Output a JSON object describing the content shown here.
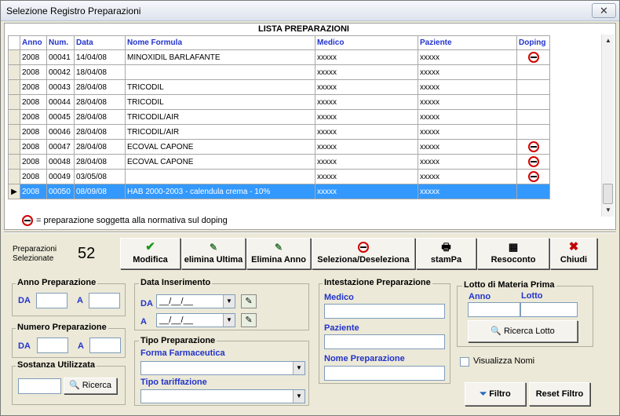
{
  "window": {
    "title": "Selezione Registro Preparazioni",
    "close_glyph": "✕"
  },
  "grid": {
    "caption": "LISTA PREPARAZIONI",
    "columns": [
      "Anno",
      "Num.",
      "Data",
      "Nome Formula",
      "Medico",
      "Paziente",
      "Doping"
    ],
    "rows": [
      [
        "2008",
        "00041",
        "14/04/08",
        "MINOXIDIL BARLAFANTE",
        "xxxxx",
        "xxxxx",
        "doping-icon"
      ],
      [
        "2008",
        "00042",
        "18/04/08",
        "",
        "xxxxx",
        "xxxxx",
        ""
      ],
      [
        "2008",
        "00043",
        "28/04/08",
        "TRICODIL",
        "xxxxx",
        "xxxxx",
        ""
      ],
      [
        "2008",
        "00044",
        "28/04/08",
        "TRICODIL",
        "xxxxx",
        "xxxxx",
        ""
      ],
      [
        "2008",
        "00045",
        "28/04/08",
        "TRICODIL/AIR",
        "xxxxx",
        "xxxxx",
        ""
      ],
      [
        "2008",
        "00046",
        "28/04/08",
        "TRICODIL/AIR",
        "xxxxx",
        "xxxxx",
        ""
      ],
      [
        "2008",
        "00047",
        "28/04/08",
        "ECOVAL CAPONE",
        "xxxxx",
        "xxxxx",
        "doping-icon"
      ],
      [
        "2008",
        "00048",
        "28/04/08",
        "ECOVAL CAPONE",
        "xxxxx",
        "xxxxx",
        "doping-icon"
      ],
      [
        "2008",
        "00049",
        "03/05/08",
        "",
        "xxxxx",
        "xxxxx",
        "doping-icon"
      ],
      [
        "2008",
        "00050",
        "08/09/08",
        "HAB 2000-2003 - calendula crema - 10%",
        "xxxxx",
        "xxxxx",
        ""
      ]
    ],
    "selected_row": 9,
    "legend": "= preparazione soggetta alla normativa sul doping"
  },
  "toolbar": {
    "count_label": "Preparazioni Selezionate",
    "count_value": "52",
    "modifica": "Modifica",
    "elimina_ultima": "elimina Ultima",
    "elimina_anno": "Elimina Anno",
    "seleziona": "Seleziona/Deseleziona",
    "stampa": "stamPa",
    "resoconto": "Resoconto",
    "chiudi": "Chiudi"
  },
  "filters": {
    "anno": {
      "title": "Anno Preparazione",
      "da": "DA",
      "a": "A"
    },
    "numero": {
      "title": "Numero Preparazione",
      "da": "DA",
      "a": "A"
    },
    "sostanza": {
      "title": "Sostanza Utilizzata",
      "button": "Ricerca"
    },
    "data": {
      "title": "Data Inserimento",
      "da": "DA",
      "a": "A",
      "da_value": "__/__/__",
      "a_value": "__/__/__"
    },
    "tipo": {
      "title": "Tipo Preparazione",
      "forma": "Forma Farmaceutica",
      "tariffazione": "Tipo tariffazione"
    },
    "intestazione": {
      "title": "Intestazione Preparazione",
      "medico": "Medico",
      "paziente": "Paziente",
      "nome": "Nome Preparazione"
    },
    "lotto": {
      "title": "Lotto di Materia Prima",
      "anno": "Anno",
      "lotto": "Lotto",
      "button": "Ricerca Lotto"
    },
    "visualizza_nomi": "Visualizza Nomi",
    "filtro": "Filtro",
    "reset": "Reset Filtro"
  }
}
